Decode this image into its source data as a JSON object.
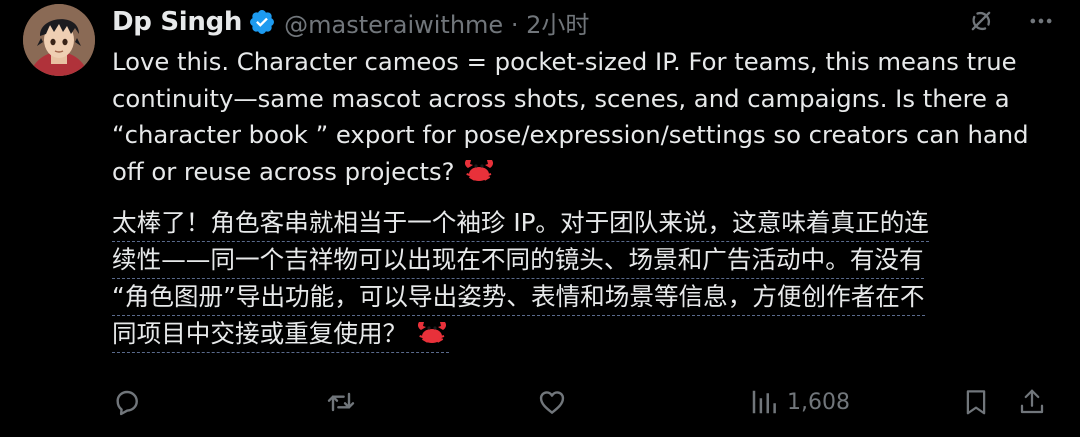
{
  "author": {
    "display_name": "Dp Singh",
    "handle_time": "@masteraiwithme · 2小时",
    "verified": true
  },
  "tweet": {
    "lines": "Love this. Character cameos = pocket-sized IP. For teams, this means true\ncontinuity—same mascot across shots, scenes, and campaigns. Is there a\n“character book ” export for pose/expression/settings so creators can hand\noff or reuse across projects?",
    "emoji_name": "crab"
  },
  "translation": {
    "lines": [
      "太棒了！角色客串就相当于一个袖珍 IP。对于团队来说，这意味着真正的连",
      "续性——同一个吉祥物可以出现在不同的镜头、场景和广告活动中。有没有",
      "“角色图册”导出功能，可以导出姿势、表情和场景等信息，方便创作者在不",
      "同项目中交接或重复使用？"
    ]
  },
  "actions": {
    "views": "1,608"
  },
  "icons": {
    "reply": "reply-icon",
    "retweet": "retweet-icon",
    "like": "like-icon",
    "views": "views-icon",
    "bookmark": "bookmark-icon",
    "share": "share-icon",
    "grok": "grok-icon",
    "more": "more-icon"
  },
  "colors": {
    "background": "#000000",
    "text": "#e7e9ea",
    "muted": "#71767b",
    "verified": "#1d9bf0",
    "crab": "#e8313a"
  }
}
